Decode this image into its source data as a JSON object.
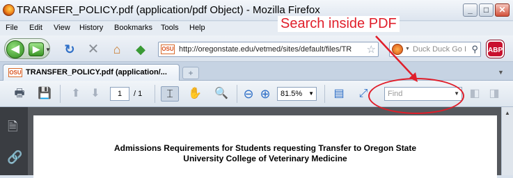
{
  "window": {
    "title": "TRANSFER_POLICY.pdf (application/pdf Object) - Mozilla Firefox",
    "controls": [
      "_",
      "□",
      "✕"
    ]
  },
  "menu": [
    "File",
    "Edit",
    "View",
    "History",
    "Bookmarks",
    "Tools",
    "Help"
  ],
  "nav": {
    "url": "http://oregonstate.edu/vetmed/sites/default/files/TR",
    "site_badge": "OSU",
    "search_placeholder": "Duck Duck Go I",
    "abp_label": "ABP"
  },
  "tab": {
    "badge": "OSU",
    "label": "TRANSFER_POLICY.pdf (application/...",
    "new_tab": "+"
  },
  "pdf_toolbar": {
    "page_current": "1",
    "page_total": "/ 1",
    "zoom": "81.5%",
    "find_placeholder": "Find"
  },
  "annotation": {
    "text": "Search inside PDF",
    "color": "#e01e2a"
  },
  "document": {
    "heading_line1": "Admissions Requirements for Students requesting Transfer to Oregon State",
    "heading_line2": "University College of Veterinary Medicine"
  }
}
